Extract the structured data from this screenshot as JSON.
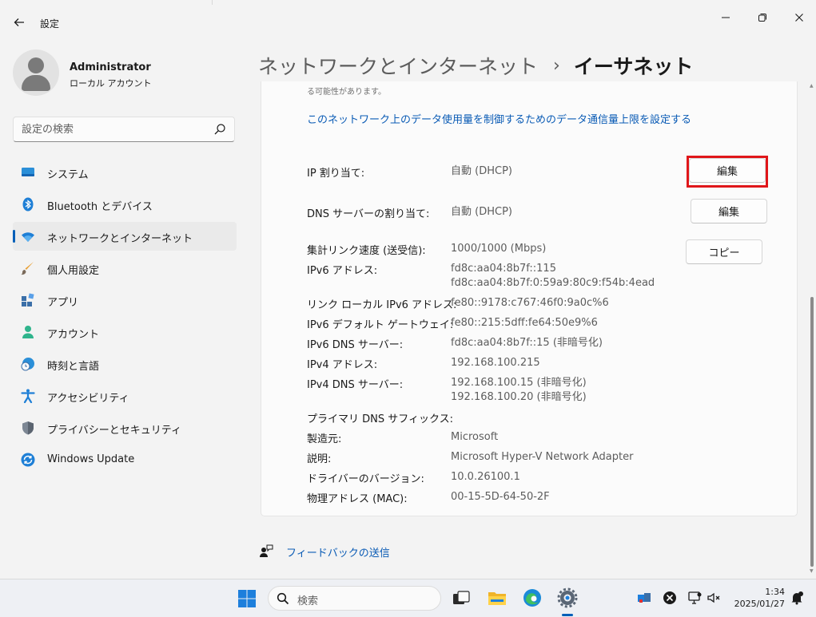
{
  "app": {
    "title": "設定",
    "back_icon": "back-arrow-icon",
    "window_controls": [
      "minimize",
      "maximize",
      "close"
    ]
  },
  "profile": {
    "name": "Administrator",
    "account_type": "ローカル アカウント"
  },
  "search": {
    "placeholder": "設定の検索",
    "icon": "search-icon"
  },
  "sidebar": {
    "items": [
      {
        "label": "システム",
        "icon": "system-icon",
        "active": false
      },
      {
        "label": "Bluetooth とデバイス",
        "icon": "bluetooth-icon",
        "active": false
      },
      {
        "label": "ネットワークとインターネット",
        "icon": "wifi-icon",
        "active": true
      },
      {
        "label": "個人用設定",
        "icon": "brush-icon",
        "active": false
      },
      {
        "label": "アプリ",
        "icon": "apps-icon",
        "active": false
      },
      {
        "label": "アカウント",
        "icon": "account-icon",
        "active": false
      },
      {
        "label": "時刻と言語",
        "icon": "time-language-icon",
        "active": false
      },
      {
        "label": "アクセシビリティ",
        "icon": "accessibility-icon",
        "active": false
      },
      {
        "label": "プライバシーとセキュリティ",
        "icon": "shield-icon",
        "active": false
      },
      {
        "label": "Windows Update",
        "icon": "windows-update-icon",
        "active": false
      }
    ]
  },
  "breadcrumb": {
    "parent": "ネットワークとインターネット",
    "separator": "›",
    "current": "イーサネット"
  },
  "main": {
    "clipped_text": "る可能性があります。",
    "data_limit_link": "このネットワーク上のデータ使用量を制御するためのデータ通信量上限を設定する",
    "ip_assignment": {
      "label": "IP 割り当て:",
      "value": "自動 (DHCP)",
      "button": "編集"
    },
    "dns_assignment": {
      "label": "DNS サーバーの割り当て:",
      "value": "自動 (DHCP)",
      "button": "編集"
    },
    "copy_button": "コピー",
    "properties": [
      {
        "label": "集計リンク速度 (送受信):",
        "values": [
          "1000/1000 (Mbps)"
        ]
      },
      {
        "label": "IPv6 アドレス:",
        "values": [
          "fd8c:aa04:8b7f::115",
          "fd8c:aa04:8b7f:0:59a9:80c9:f54b:4ead"
        ]
      },
      {
        "label": "リンク ローカル IPv6 アドレス:",
        "values": [
          "fe80::9178:c767:46f0:9a0c%6"
        ]
      },
      {
        "label": "IPv6 デフォルト ゲートウェイ:",
        "values": [
          "fe80::215:5dff:fe64:50e9%6"
        ]
      },
      {
        "label": "IPv6 DNS サーバー:",
        "values": [
          "fd8c:aa04:8b7f::15 (非暗号化)"
        ]
      },
      {
        "label": "IPv4 アドレス:",
        "values": [
          "192.168.100.215"
        ]
      },
      {
        "label": "IPv4 DNS サーバー:",
        "values": [
          "192.168.100.15 (非暗号化)",
          "192.168.100.20 (非暗号化)"
        ]
      },
      {
        "label": "プライマリ DNS サフィックス:",
        "values": []
      },
      {
        "label": "製造元:",
        "values": [
          "Microsoft"
        ]
      },
      {
        "label": "説明:",
        "values": [
          "Microsoft Hyper-V Network Adapter"
        ]
      },
      {
        "label": "ドライバーのバージョン:",
        "values": [
          "10.0.26100.1"
        ]
      },
      {
        "label": "物理アドレス (MAC):",
        "values": [
          "00-15-5D-64-50-2F"
        ]
      }
    ]
  },
  "feedback": {
    "label": "フィードバックの送信",
    "icon": "feedback-icon"
  },
  "taskbar": {
    "search_label": "検索",
    "apps": [
      "start-icon",
      "task-view-icon",
      "file-explorer-icon",
      "edge-icon",
      "settings-icon"
    ],
    "tray": [
      "network-alert-icon",
      "close-circle-icon",
      "display-icon",
      "volume-muted-icon",
      "notification-icon"
    ],
    "time": "1:34",
    "date": "2025/01/27"
  },
  "colors": {
    "accent": "#005fb8",
    "link": "#0a5bb5",
    "highlight_box": "#e0161a"
  }
}
